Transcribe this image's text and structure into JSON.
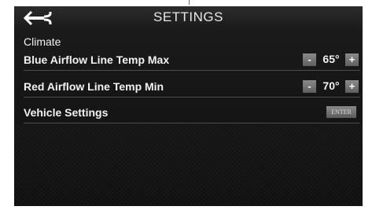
{
  "header": {
    "title": "SETTINGS",
    "back_icon": "back-arrow-icon"
  },
  "section": {
    "label": "Climate"
  },
  "rows": [
    {
      "label": "Blue Airflow Line Temp Max",
      "minus": "-",
      "value": "65°",
      "plus": "+"
    },
    {
      "label": "Red Airflow Line Temp Min",
      "minus": "-",
      "value": "70°",
      "plus": "+"
    }
  ],
  "vehicle": {
    "label": "Vehicle Settings",
    "button": "ENTER"
  },
  "colors": {
    "background": "#141414",
    "text": "#f2f2f2",
    "button": "#7a7a7a",
    "divider": "#4a4a4a"
  }
}
